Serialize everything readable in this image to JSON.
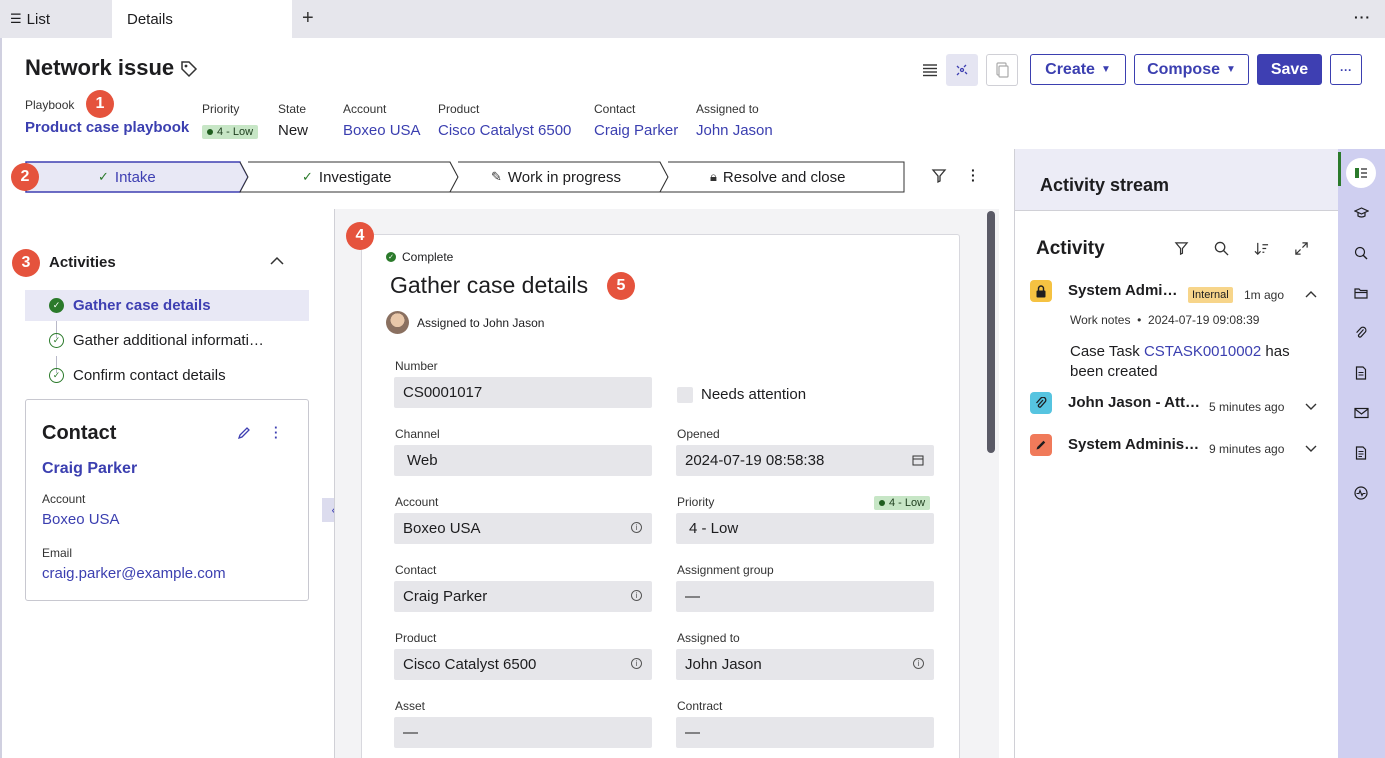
{
  "tabs": {
    "list": "List",
    "details": "Details"
  },
  "header": {
    "title": "Network issue",
    "playbook": {
      "label": "Playbook",
      "value": "Product case playbook"
    },
    "fields": [
      {
        "label": "Priority",
        "value": "4 - Low"
      },
      {
        "label": "State",
        "value": "New"
      },
      {
        "label": "Account",
        "value": "Boxeo USA"
      },
      {
        "label": "Product",
        "value": "Cisco Catalyst 6500"
      },
      {
        "label": "Contact",
        "value": "Craig Parker"
      },
      {
        "label": "Assigned to",
        "value": "John Jason"
      }
    ],
    "buttons": {
      "create": "Create",
      "compose": "Compose",
      "save": "Save"
    }
  },
  "callouts": [
    "1",
    "2",
    "3",
    "4",
    "5"
  ],
  "stages": [
    "Intake",
    "Investigate",
    "Work in progress",
    "Resolve and close"
  ],
  "activities": {
    "title": "Activities",
    "items": [
      "Gather case details",
      "Gather additional informati…",
      "Confirm contact details"
    ]
  },
  "contact_card": {
    "title": "Contact",
    "name": "Craig Parker",
    "account_label": "Account",
    "account": "Boxeo USA",
    "email_label": "Email",
    "email": "craig.parker@example.com"
  },
  "form": {
    "status": "Complete",
    "title": "Gather case details",
    "assigned": "Assigned to John Jason",
    "number": {
      "label": "Number",
      "value": "CS0001017"
    },
    "needs_attention": "Needs attention",
    "channel": {
      "label": "Channel",
      "value": "Web"
    },
    "opened": {
      "label": "Opened",
      "value": "2024-07-19 08:58:38"
    },
    "account": {
      "label": "Account",
      "value": "Boxeo USA"
    },
    "priority": {
      "label": "Priority",
      "value": "4 - Low",
      "badge": "4 - Low"
    },
    "contact": {
      "label": "Contact",
      "value": "Craig Parker"
    },
    "assignment_group": {
      "label": "Assignment group",
      "value": "—"
    },
    "product": {
      "label": "Product",
      "value": "Cisco Catalyst 6500"
    },
    "assigned_to": {
      "label": "Assigned to",
      "value": "John Jason"
    },
    "asset": {
      "label": "Asset",
      "value": "—"
    },
    "contract": {
      "label": "Contract",
      "value": "—"
    }
  },
  "stream": {
    "header": "Activity stream",
    "title": "Activity",
    "entries": [
      {
        "name": "System Admi…",
        "badge": "Internal",
        "time": "1m ago",
        "meta": "Work notes",
        "meta_time": "2024-07-19 09:08:39",
        "text_prefix": "Case Task ",
        "text_link": "CSTASK0010002",
        "text_suffix": " has",
        "text_line2": "been created"
      },
      {
        "name": "John Jason - Att…",
        "time": "5 minutes ago"
      },
      {
        "name": "System Adminis…",
        "time": "9 minutes ago"
      }
    ]
  },
  "colors": {
    "accent": "#3e3fb2",
    "success": "#2b7a2b",
    "callout": "#e5533d",
    "internal_badge": "#f7d58a"
  }
}
